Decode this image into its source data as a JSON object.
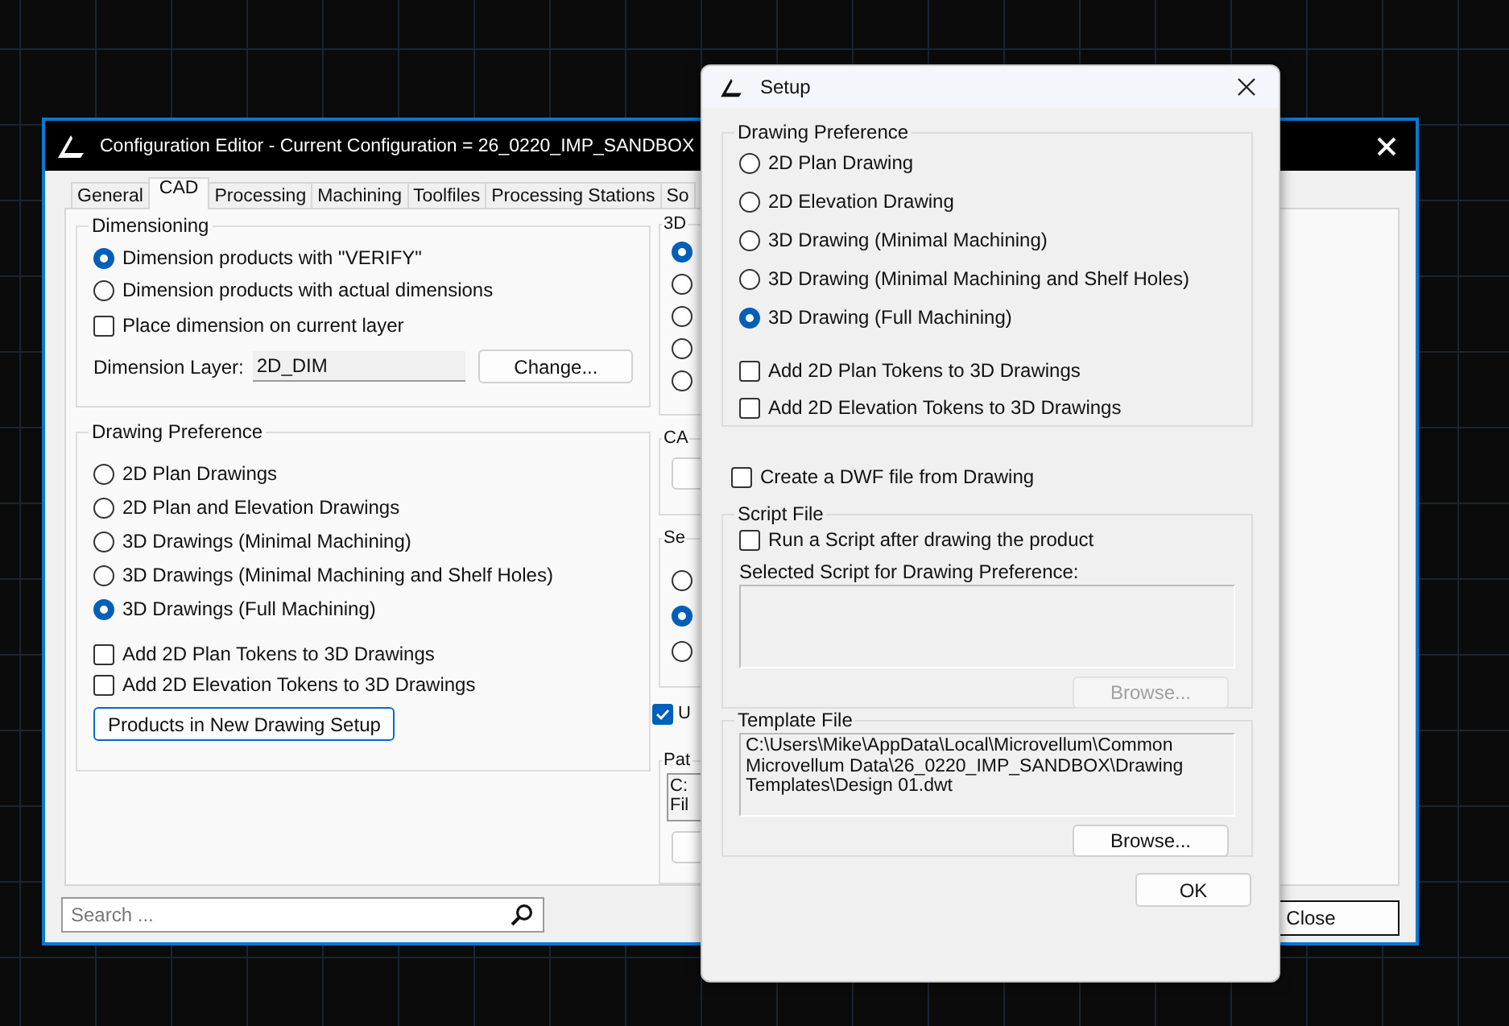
{
  "main_window": {
    "title": "Configuration Editor - Current Configuration = 26_0220_IMP_SANDBOX",
    "tabs": [
      {
        "label": "General",
        "selected": false
      },
      {
        "label": "CAD",
        "selected": true
      },
      {
        "label": "Processing",
        "selected": false
      },
      {
        "label": "Machining",
        "selected": false
      },
      {
        "label": "Toolfiles",
        "selected": false
      },
      {
        "label": "Processing Stations",
        "selected": false
      },
      {
        "label": "So",
        "selected": false
      }
    ],
    "dimensioning": {
      "title": "Dimensioning",
      "options": [
        {
          "label": "Dimension products with \"VERIFY\"",
          "selected": true
        },
        {
          "label": "Dimension products with actual dimensions",
          "selected": false
        }
      ],
      "place_on_current_layer": {
        "label": "Place dimension on current layer",
        "checked": false
      },
      "layer_label": "Dimension Layer:",
      "layer_value": "2D_DIM",
      "change_button": "Change..."
    },
    "drawing_preference": {
      "title": "Drawing Preference",
      "options": [
        {
          "label": "2D Plan Drawings",
          "selected": false
        },
        {
          "label": "2D Plan and Elevation Drawings",
          "selected": false
        },
        {
          "label": "3D Drawings (Minimal Machining)",
          "selected": false
        },
        {
          "label": "3D Drawings (Minimal Machining and Shelf Holes)",
          "selected": false
        },
        {
          "label": "3D Drawings (Full Machining)",
          "selected": true
        }
      ],
      "tokens": [
        {
          "label": "Add 2D Plan Tokens to 3D Drawings",
          "checked": false
        },
        {
          "label": "Add 2D Elevation Tokens to 3D Drawings",
          "checked": false
        }
      ],
      "setup_button": "Products in New Drawing Setup"
    },
    "right_column": {
      "group_1": {
        "title": "3D",
        "options": [
          {
            "selected": true
          },
          {
            "selected": false
          },
          {
            "selected": false
          },
          {
            "selected": false
          },
          {
            "selected": false
          }
        ]
      },
      "group_2": {
        "title": "CA"
      },
      "group_3": {
        "title": "Se",
        "options": [
          {
            "selected": false
          },
          {
            "selected": true
          },
          {
            "selected": false
          }
        ]
      },
      "checkbox": {
        "label": "U",
        "checked": true
      },
      "group_4": {
        "title": "Pat",
        "path_lines": [
          "C:",
          "Fil"
        ]
      }
    },
    "search": {
      "placeholder": "Search ..."
    },
    "close_button": "Close"
  },
  "setup_dialog": {
    "title": "Setup",
    "drawing_preference": {
      "title": "Drawing Preference",
      "options": [
        {
          "label": "2D Plan Drawing",
          "selected": false
        },
        {
          "label": "2D Elevation Drawing",
          "selected": false
        },
        {
          "label": "3D Drawing (Minimal Machining)",
          "selected": false
        },
        {
          "label": "3D Drawing (Minimal Machining and Shelf Holes)",
          "selected": false
        },
        {
          "label": "3D Drawing (Full Machining)",
          "selected": true
        }
      ],
      "tokens": [
        {
          "label": "Add 2D Plan Tokens to 3D Drawings",
          "checked": false
        },
        {
          "label": "Add 2D Elevation Tokens to 3D Drawings",
          "checked": false
        }
      ]
    },
    "create_dwf": {
      "label": "Create a DWF file from Drawing",
      "checked": false
    },
    "script_file": {
      "title": "Script File",
      "run_script": {
        "label": "Run a Script after drawing the product",
        "checked": false
      },
      "selected_label": "Selected Script for Drawing Preference:",
      "browse_button": {
        "label": "Browse...",
        "disabled": true
      }
    },
    "template_file": {
      "title": "Template File",
      "path": "C:\\Users\\Mike\\AppData\\Local\\Microvellum\\Common Microvellum Data\\26_0220_IMP_SANDBOX\\Drawing Templates\\Design 01.dwt",
      "browse_button": {
        "label": "Browse...",
        "disabled": false
      }
    },
    "ok_button": "OK"
  }
}
